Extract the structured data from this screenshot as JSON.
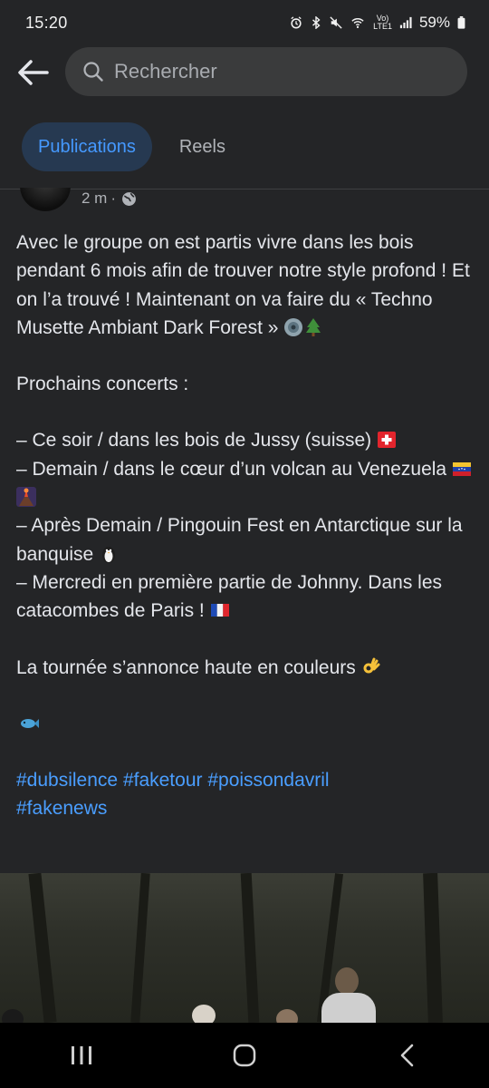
{
  "status_bar": {
    "time": "15:20",
    "network_tag_top": "Vo)",
    "network_tag_bottom": "LTE1",
    "battery": "59%"
  },
  "search": {
    "placeholder": "Rechercher"
  },
  "tabs": [
    {
      "label": "Publications",
      "active": true
    },
    {
      "label": "Reels",
      "active": false
    }
  ],
  "post": {
    "time": "2 m",
    "separator": "·",
    "paragraphs": {
      "intro": "Avec le groupe on est partis vivre dans les bois pendant 6 mois afin de trouver notre style profond ! Et on l’a trouvé ! Maintenant on va faire du « Techno Musette Ambiant Dark Forest »",
      "concerts_title": "Prochains concerts :",
      "concert_1": "– Ce soir / dans les bois de Jussy (suisse)",
      "concert_2": "– Demain / dans le cœur d’un volcan au Venezuela",
      "concert_3": "– Après Demain / Pingouin Fest en Antarctique sur la banquise",
      "concert_4": "– Mercredi en première partie de Johnny. Dans les catacombes de Paris !",
      "closing": "La tournée s’annonce haute en couleurs"
    },
    "hashtags": [
      "#dubsilence",
      "#faketour",
      "#poissondavril",
      "#fakenews"
    ]
  },
  "colors": {
    "background": "#242527",
    "tab_active_bg": "#263951",
    "tab_active_text": "#4599ff",
    "link": "#4a9eff"
  }
}
